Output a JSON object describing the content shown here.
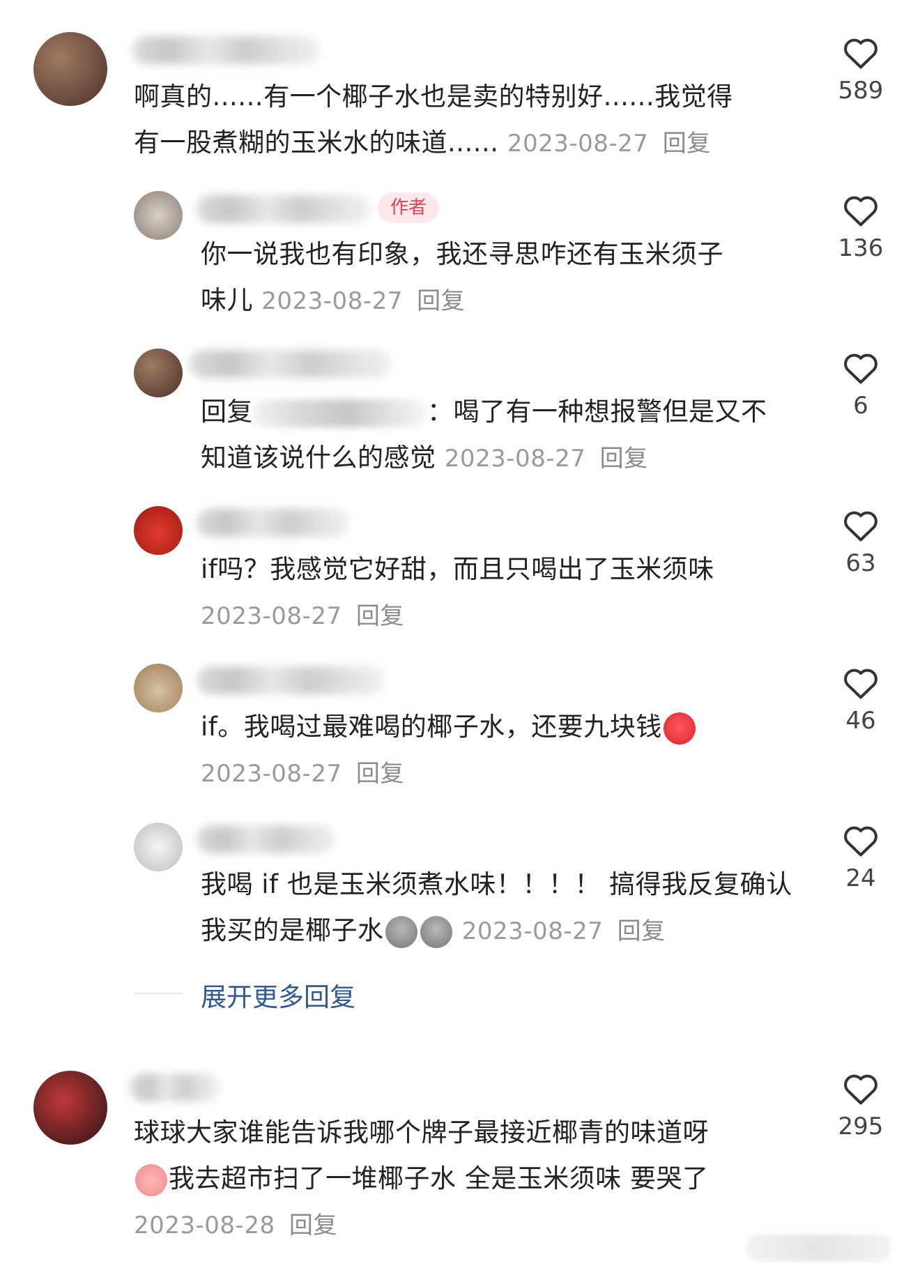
{
  "comments": [
    {
      "text": "啊真的......有一个椰子水也是卖的特别好......我觉得",
      "text2": "有一股煮糊的玉米水的味道......",
      "date": "2023-08-27",
      "reply": "回复",
      "likes": "589"
    },
    {
      "author_tag": "作者",
      "text": "你一说我也有印象，我还寻思咋还有玉米须子",
      "text2": "味儿",
      "date": "2023-08-27",
      "reply": "回复",
      "likes": "136"
    },
    {
      "prefix": "回复",
      "text": "：喝了有一种想报警但是又不",
      "text2": "知道该说什么的感觉",
      "date": "2023-08-27",
      "reply": "回复",
      "likes": "6"
    },
    {
      "text": "if吗？我感觉它好甜，而且只喝出了玉米须味",
      "date": "2023-08-27",
      "reply": "回复",
      "likes": "63"
    },
    {
      "text": "if。我喝过最难喝的椰子水，还要九块钱",
      "date": "2023-08-27",
      "reply": "回复",
      "likes": "46"
    },
    {
      "text": "我喝 if 也是玉米须煮水味！！！！ 搞得我反复确认",
      "text2": "我买的是椰子水",
      "date": "2023-08-27",
      "reply": "回复",
      "likes": "24"
    },
    {
      "text": "球球大家谁能告诉我哪个牌子最接近椰青的味道呀",
      "text2": "我去超市扫了一堆椰子水 全是玉米须味 要哭了",
      "date": "2023-08-28",
      "reply": "回复",
      "likes": "295"
    }
  ],
  "expand_replies": "展开更多回复",
  "colors": {
    "author_tag_bg": "#fde9ec",
    "author_tag_text": "#ea3f57",
    "link": "#2f5a8c",
    "meta": "#9a9a9a"
  },
  "icons": {
    "like": "heart-outline-icon",
    "emoji_angry": "angry-face-emoji",
    "emoji_potato": "potato-emoji",
    "emoji_peach": "crying-peach-emoji"
  }
}
